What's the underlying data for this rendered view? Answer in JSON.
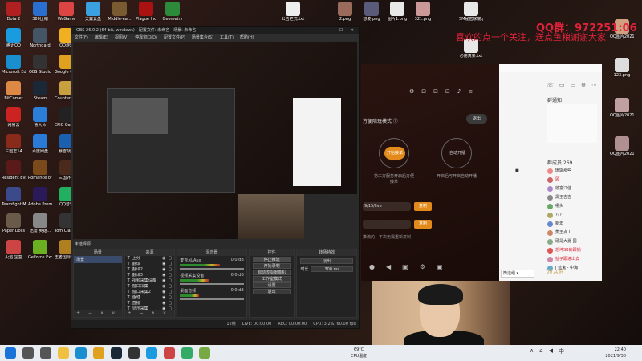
{
  "desktop_icons_left": [
    {
      "label": "Dota 2",
      "color": "#b02020"
    },
    {
      "label": "360压缩",
      "color": "#2a6fd0"
    },
    {
      "label": "WeGame",
      "color": "#d44"
    },
    {
      "label": "天翼云盘",
      "color": "#3aa0e0"
    },
    {
      "label": "Middle-ea...",
      "color": "#7a5a30"
    },
    {
      "label": "Plague Inc",
      "color": "#a11"
    },
    {
      "label": "Geometry",
      "color": "#2c8a3a"
    },
    {
      "label": "腾讯QQ",
      "color": "#1a9be0"
    },
    {
      "label": "Northgard",
      "color": "#445566"
    },
    {
      "label": "QQ游戏",
      "color": "#f0b020"
    },
    {
      "label": "Microsoft Edge",
      "color": "#1a8fd0"
    },
    {
      "label": "OBS Studio",
      "color": "#333"
    },
    {
      "label": "Google Chrome",
      "color": "#e0a020"
    },
    {
      "label": "BitComet",
      "color": "#d84"
    },
    {
      "label": "Steam",
      "color": "#1b2838"
    },
    {
      "label": "Counter-Strike Global",
      "color": "#c9a040"
    },
    {
      "label": "网易云",
      "color": "#c22"
    },
    {
      "label": "鲁大师",
      "color": "#2c7fd8"
    },
    {
      "label": "EPIC Games Epic Launch",
      "color": "#222"
    },
    {
      "label": "三国志14",
      "color": "#8a2a1a"
    },
    {
      "label": "百度网盘",
      "color": "#2a7ad8"
    },
    {
      "label": "暴雪战网",
      "color": "#1a5fb0"
    },
    {
      "label": "Resident Evil Village",
      "color": "#5a1a1a"
    },
    {
      "label": "Romance of the Three...",
      "color": "#7a4a1a"
    },
    {
      "label": "三国外传",
      "color": "#4a2a1a"
    },
    {
      "label": "Teamfight Manager",
      "color": "#3a4a8a"
    },
    {
      "label": "Adobe Premiere...",
      "color": "#2a1a5a"
    },
    {
      "label": "QQ音乐",
      "color": "#20b060"
    },
    {
      "label": "Paper Dolls",
      "color": "#6a5a4a"
    },
    {
      "label": "迅雷 英雄...",
      "color": "#888"
    },
    {
      "label": "Tom Clancy's",
      "color": "#333"
    },
    {
      "label": "火焰 宝盒",
      "color": "#c44"
    },
    {
      "label": "GeForce Experience",
      "color": "#6ab020"
    },
    {
      "label": "王者国际 网络",
      "color": "#b08020"
    }
  ],
  "desktop_files_right": [
    {
      "label": "公告栏式.txt",
      "color": "#eee"
    },
    {
      "label": "2.png",
      "color": "#9a6a5a"
    },
    {
      "label": "想要.png",
      "color": "#5a5a7a"
    },
    {
      "label": "图片1.png",
      "color": "#e8e8e8"
    },
    {
      "label": "321.png",
      "color": "#c99"
    },
    {
      "label": "SM秘密家底.png",
      "color": "#e8e8e8"
    },
    {
      "label": "必用真果.txt",
      "color": "#e8e8e8"
    },
    {
      "label": "QQ图片2021051...",
      "color": "#d0a080"
    },
    {
      "label": "123.png",
      "color": "#ddd"
    },
    {
      "label": "QQ图片20211117...",
      "color": "#c0a0a0"
    },
    {
      "label": "QQ图片2021023...",
      "color": "#b09090"
    }
  ],
  "overlay": {
    "qq_group": "QQ群：972251:06",
    "subscribe": "喜欢的点一个关注，送点鱼粮谢谢大家"
  },
  "obs": {
    "title": "OBS 26.0.2 (64-bit, windows) - 配置文件: 未命名 - 场景: 未命名",
    "window_controls": "— ☐ ✕",
    "menu": [
      "文件(F)",
      "编辑(E)",
      "视图(V)",
      "停靠窗口(D)",
      "配置文件(P)",
      "场景集合(S)",
      "工具(T)",
      "帮助(H)"
    ],
    "source_label": "未选择源",
    "dock_headers": [
      "场景",
      "来源",
      "混音器",
      "控件",
      "转场特效"
    ],
    "scenes": [
      "场景"
    ],
    "sources": [
      "上分",
      "翻译",
      "翻译2",
      "翻译3",
      "视频采集设备",
      "窗口采集",
      "窗口采集2",
      "鱼塘",
      "直播",
      "显示采集"
    ],
    "mixer_tracks": [
      {
        "name": "麦克风/Aux",
        "db": "0.0 dB",
        "level": 0.62
      },
      {
        "name": "视频采集设备",
        "db": "0.0 dB",
        "level": 0.45
      },
      {
        "name": "桌面音频",
        "db": "0.0 dB",
        "level": 0.3
      }
    ],
    "controls": [
      "停止推流",
      "开始录制",
      "启动虚拟摄像机",
      "工作室模式",
      "设置",
      "退出"
    ],
    "transition": {
      "type": "淡出",
      "duration_label": "时长",
      "duration": "300 ms"
    },
    "dock_footer": "+ − ∧ ∨",
    "status": {
      "live": "LIVE: 00:00:00",
      "rec": "REC: 00:00:00",
      "cpu": "CPU: 3.2%, 60.00 fps",
      "dropped": "12帧"
    }
  },
  "app": {
    "mode_label": "方便陪玩模式",
    "exit": "退出",
    "circle1": {
      "label": "开始接单",
      "badge": "3",
      "caption": "第三方服务开启后方便接单"
    },
    "circle2": {
      "label": "自动开播",
      "badge": "4",
      "caption": "开启后可开启自动开播"
    },
    "input1": "9/15/live",
    "input2": "",
    "copy1": "复制",
    "copy2": "复制",
    "hint": "推流的，下次无需重新复制",
    "members_label": "群成员 269",
    "section_title": "群通知",
    "group_members": [
      {
        "name": "珊瑚那些",
        "color": "#e88",
        "red": false
      },
      {
        "name": "顾",
        "color": "#c66",
        "red": true
      },
      {
        "name": "啟富江佳",
        "color": "#a8c",
        "red": false
      },
      {
        "name": "黑王吉吉",
        "color": "#888",
        "red": false
      },
      {
        "name": "哪头",
        "color": "#6a6",
        "red": false
      },
      {
        "name": "???",
        "color": "#aa6",
        "red": false
      },
      {
        "name": "新年",
        "color": "#68c",
        "red": false
      },
      {
        "name": "集王点 L",
        "color": "#c86",
        "red": false
      },
      {
        "name": "硬是大夏 国",
        "color": "#8a8",
        "red": false
      },
      {
        "name": "想坤SB的跟锅",
        "color": "#d55",
        "red": true
      },
      {
        "name": "扯子跟进出去",
        "color": "#c8a",
        "red": true
      },
      {
        "name": "J 蓝鬼 - 中海",
        "color": "#6ac",
        "red": false
      }
    ],
    "dropdown": "筒选组 ▾",
    "watermark": "WAR"
  },
  "taskbar": {
    "apps": [
      {
        "name": "start",
        "color": "#1a73d8"
      },
      {
        "name": "search",
        "color": "#555"
      },
      {
        "name": "task-view",
        "color": "#555"
      },
      {
        "name": "explorer",
        "color": "#f0c040"
      },
      {
        "name": "edge",
        "color": "#1a8fd0"
      },
      {
        "name": "chrome",
        "color": "#e0a020"
      },
      {
        "name": "steam",
        "color": "#1b2838"
      },
      {
        "name": "obs",
        "color": "#333"
      },
      {
        "name": "qq",
        "color": "#1a9be0"
      },
      {
        "name": "app1",
        "color": "#c44"
      },
      {
        "name": "app2",
        "color": "#3a6"
      },
      {
        "name": "app3",
        "color": "#7a4"
      }
    ],
    "temp": "69°C",
    "temp_label": "CPU温度",
    "time": "22:40",
    "date": "2021/9/30"
  }
}
